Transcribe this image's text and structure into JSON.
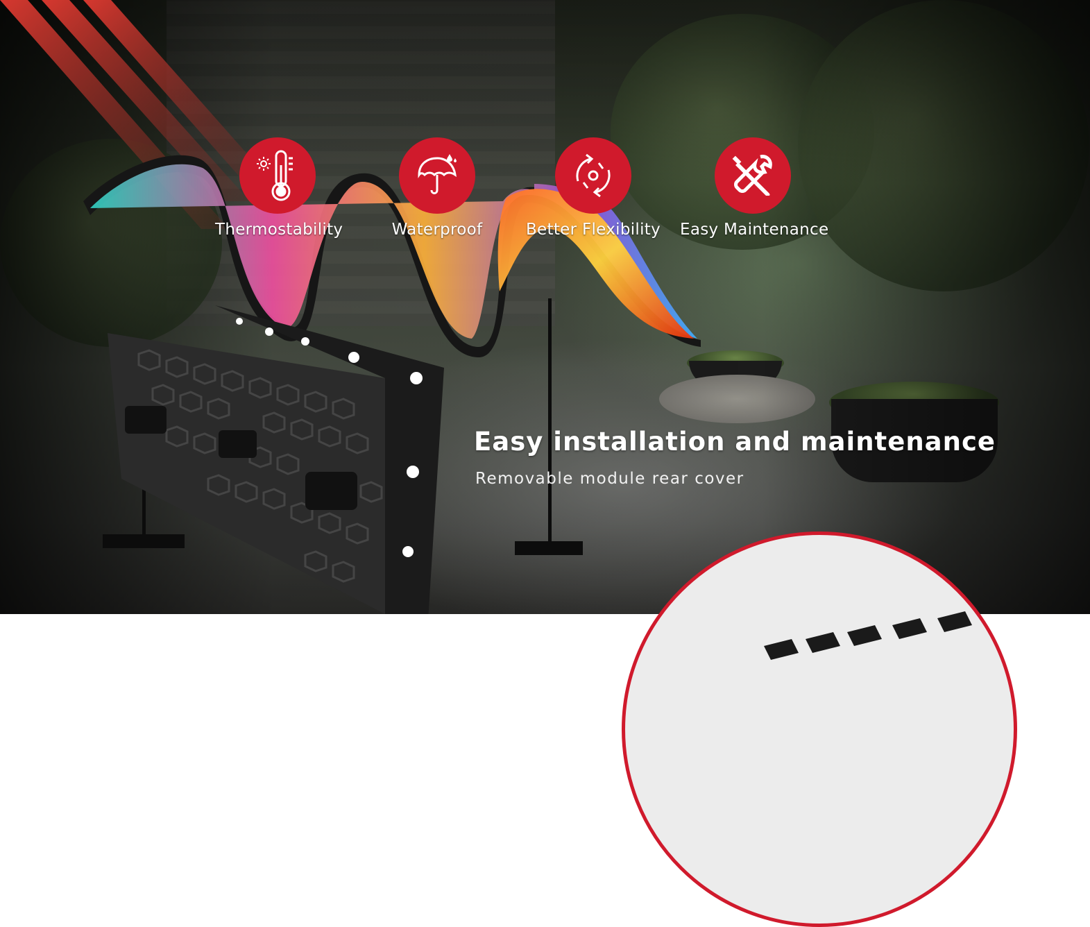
{
  "features": [
    {
      "icon": "thermometer-sun-icon",
      "label": "Thermostability"
    },
    {
      "icon": "umbrella-rain-icon",
      "label": "Waterproof"
    },
    {
      "icon": "rotate-arrows-icon",
      "label": "Better Flexibility"
    },
    {
      "icon": "wrench-screwdriver-icon",
      "label": "Easy Maintenance"
    }
  ],
  "headline": "Easy installation and maintenance",
  "subheadline": "Removable module rear cover",
  "colors": {
    "accent": "#d01a2c",
    "text": "#ffffff"
  }
}
